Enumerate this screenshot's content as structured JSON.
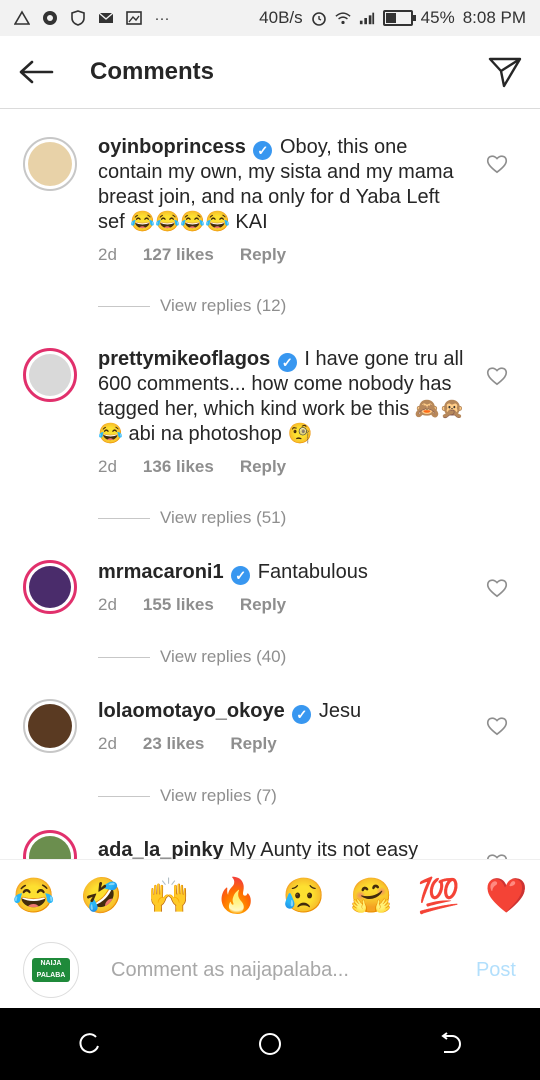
{
  "status_bar": {
    "network_speed": "40B/s",
    "battery": "45%",
    "battery_fraction": 0.45,
    "time": "8:08 PM",
    "icons": [
      "triangle-warning-icon",
      "circle-app-icon",
      "shield-icon",
      "gmail-icon",
      "image-icon",
      "more-dots-icon",
      "alarm-icon",
      "wifi-icon",
      "signal-icon",
      "battery-icon"
    ]
  },
  "header": {
    "title": "Comments",
    "back_icon": "back-arrow-icon",
    "direct_icon": "send-paper-plane-icon"
  },
  "comments": [
    {
      "username": "oyinboprincess",
      "verified": true,
      "text": "Oboy, this one contain my own, my sista and my mama breast join, and na only for d Yaba Left sef 😂😂😂😂 KAI",
      "age": "2d",
      "likes": "127 likes",
      "reply": "Reply",
      "view_replies": "View replies (12)",
      "avatar_color": "#e8d2a8",
      "avatar_ring": false
    },
    {
      "username": "prettymikeoflagos",
      "verified": true,
      "text": "I have gone tru all 600 comments... how come nobody has tagged her, which kind work be this 🙈🙊😂 abi na photoshop 🧐",
      "age": "2d",
      "likes": "136 likes",
      "reply": "Reply",
      "view_replies": "View replies (51)",
      "avatar_color": "#d9d9d9",
      "avatar_ring": true
    },
    {
      "username": "mrmacaroni1",
      "verified": true,
      "text": "Fantabulous",
      "age": "2d",
      "likes": "155 likes",
      "reply": "Reply",
      "view_replies": "View replies (40)",
      "avatar_color": "#4a2c6b",
      "avatar_ring": true
    },
    {
      "username": "lolaomotayo_okoye",
      "verified": true,
      "text": "Jesu",
      "age": "2d",
      "likes": "23 likes",
      "reply": "Reply",
      "view_replies": "View replies (7)",
      "avatar_color": "#5a3a22",
      "avatar_ring": false
    },
    {
      "username": "ada_la_pinky",
      "verified": false,
      "text": "My Aunty its not easy",
      "age": "",
      "likes": "",
      "reply": "",
      "view_replies": "",
      "avatar_color": "#6b8e4e",
      "avatar_ring": true
    }
  ],
  "emoji_bar": [
    "😂",
    "🤣",
    "🙌",
    "🔥",
    "😥",
    "🤗",
    "💯",
    "❤️"
  ],
  "composer": {
    "placeholder": "Comment as naijapalaba...",
    "post_label": "Post",
    "avatar_text": "NAIJA PALABA"
  },
  "nav": {
    "icons": [
      "recent-apps-icon",
      "home-circle-icon",
      "back-icon"
    ]
  },
  "colors": {
    "verified": "#3897f0",
    "story_ring": "#e1306c",
    "post_disabled": "#b2dffc",
    "meta_gray": "#8e8e8e"
  }
}
